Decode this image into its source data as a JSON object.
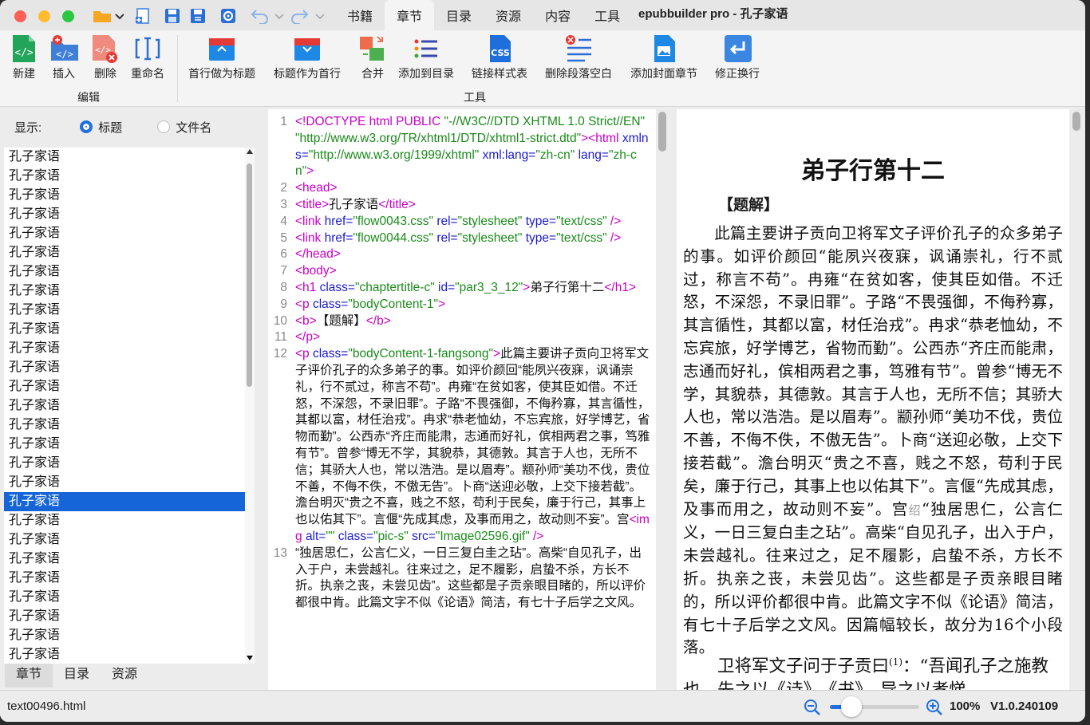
{
  "window": {
    "title": "epubbuilder pro - 孔子家语"
  },
  "menu": {
    "tabs": [
      "书籍",
      "章节",
      "目录",
      "资源",
      "内容",
      "工具"
    ],
    "active_tab": "章节"
  },
  "ribbon": {
    "edit_group": {
      "label": "编辑",
      "buttons": [
        "新建",
        "插入",
        "删除",
        "重命名"
      ]
    },
    "tools_group": {
      "label": "工具",
      "buttons": [
        "首行做为标题",
        "标题作为首行",
        "合并",
        "添加到目录",
        "链接样式表",
        "删除段落空白",
        "添加封面章节",
        "修正换行"
      ]
    }
  },
  "left_panel": {
    "display_label": "显示:",
    "option_title": "标题",
    "option_filename": "文件名",
    "selected_option": "标题",
    "items": [
      "孔子家语",
      "孔子家语",
      "孔子家语",
      "孔子家语",
      "孔子家语",
      "孔子家语",
      "孔子家语",
      "孔子家语",
      "孔子家语",
      "孔子家语",
      "孔子家语",
      "孔子家语",
      "孔子家语",
      "孔子家语",
      "孔子家语",
      "孔子家语",
      "孔子家语",
      "孔子家语",
      "孔子家语",
      "孔子家语",
      "孔子家语",
      "孔子家语",
      "孔子家语",
      "孔子家语",
      "孔子家语",
      "孔子家语",
      "孔子家语"
    ],
    "selected_index": 18,
    "bottom_tabs": [
      "章节",
      "目录",
      "资源"
    ],
    "active_bottom_tab": "章节"
  },
  "editor": {
    "lines": [
      {
        "n": "1",
        "parts": [
          [
            "t",
            "<!DOCTYPE html PUBLIC "
          ],
          [
            "s",
            "\"-//W3C//DTD XHTML 1.0 Strict//EN\" \"http://www.w3.org/TR/xhtml1/DTD/xhtml1-strict.dtd\""
          ],
          [
            "t",
            "><html "
          ],
          [
            "a",
            "xmlns="
          ],
          [
            "s",
            "\"http://www.w3.org/1999/xhtml\" "
          ],
          [
            "a",
            "xml:lang="
          ],
          [
            "s",
            "\"zh-cn\" "
          ],
          [
            "a",
            "lang="
          ],
          [
            "s",
            "\"zh-cn\""
          ],
          [
            "t",
            ">"
          ]
        ]
      },
      {
        "n": "2",
        "parts": [
          [
            "t",
            "<head>"
          ]
        ]
      },
      {
        "n": "3",
        "parts": [
          [
            "t",
            "<title>"
          ],
          [
            "x",
            "孔子家语"
          ],
          [
            "t",
            "</title>"
          ]
        ]
      },
      {
        "n": "4",
        "parts": [
          [
            "t",
            "<link "
          ],
          [
            "a",
            "href="
          ],
          [
            "s",
            "\"flow0043.css\" "
          ],
          [
            "a",
            "rel="
          ],
          [
            "s",
            "\"stylesheet\" "
          ],
          [
            "a",
            "type="
          ],
          [
            "s",
            "\"text/css\" "
          ],
          [
            "t",
            "/>"
          ]
        ]
      },
      {
        "n": "5",
        "parts": [
          [
            "t",
            "<link "
          ],
          [
            "a",
            "href="
          ],
          [
            "s",
            "\"flow0044.css\" "
          ],
          [
            "a",
            "rel="
          ],
          [
            "s",
            "\"stylesheet\" "
          ],
          [
            "a",
            "type="
          ],
          [
            "s",
            "\"text/css\" "
          ],
          [
            "t",
            "/>"
          ]
        ]
      },
      {
        "n": "6",
        "parts": [
          [
            "t",
            "</head>"
          ]
        ]
      },
      {
        "n": "7",
        "parts": [
          [
            "t",
            "<body>"
          ]
        ]
      },
      {
        "n": "8",
        "parts": [
          [
            "t",
            "<h1 "
          ],
          [
            "a",
            "class="
          ],
          [
            "s",
            "\"chaptertitle-c\" "
          ],
          [
            "a",
            "id="
          ],
          [
            "s",
            "\"par3_3_12\""
          ],
          [
            "t",
            ">"
          ],
          [
            "x",
            "弟子行第十二"
          ],
          [
            "t",
            "</h1>"
          ]
        ]
      },
      {
        "n": "9",
        "parts": [
          [
            "t",
            "<p "
          ],
          [
            "a",
            "class="
          ],
          [
            "s",
            "\"bodyContent-1\""
          ],
          [
            "t",
            ">"
          ]
        ]
      },
      {
        "n": "10",
        "parts": [
          [
            "t",
            "<b>"
          ],
          [
            "x",
            "【题解】"
          ],
          [
            "t",
            "</b>"
          ]
        ]
      },
      {
        "n": "11",
        "parts": [
          [
            "t",
            "</p>"
          ]
        ]
      },
      {
        "n": "12",
        "parts": [
          [
            "t",
            "<p "
          ],
          [
            "a",
            "class="
          ],
          [
            "s",
            "\"bodyContent-1-fangsong\""
          ],
          [
            "t",
            ">"
          ],
          [
            "x",
            "此篇主要讲子贡向卫将军文子评价孔子的众多弟子的事。如评价颜回“能夙兴夜寐，讽诵崇礼，行不贰过，称言不苟”。冉雍“在贫如客，使其臣如借。不迁怒，不深怨，不录旧罪”。子路“不畏强御，不侮矜寡，其言循性，其都以富，材任治戎”。冉求“恭老恤幼，不忘宾旅，好学博艺，省物而勤”。公西赤“齐庄而能肃，志通而好礼，傧相两君之事，笃雅有节”。曾参“博无不学，其貌恭，其德敦。其言于人也，无所不信；其骄大人也，常以浩浩。是以眉寿”。颛孙师“美功不伐，贵位不善，不侮不佚，不傲无告”。卜商“送迎必敬，上交下接若截”。澹台明灭“贵之不喜，贱之不怒，苟利于民矣，廉于行己，其事上也以佑其下”。言偃“先成其虑，及事而用之，故动则不妄”。宫"
          ],
          [
            "t",
            "<img "
          ],
          [
            "a",
            "alt="
          ],
          [
            "s",
            "\"\" "
          ],
          [
            "a",
            "class="
          ],
          [
            "s",
            "\"pic-s\" "
          ],
          [
            "a",
            "src="
          ],
          [
            "s",
            "\"Image02596.gif\" "
          ],
          [
            "t",
            "/>"
          ]
        ]
      },
      {
        "n": "13",
        "parts": [
          [
            "x",
            "“独居思仁，公言仁义，一日三复白圭之玷”。高柴“自见孔子，出入于户，未尝越礼。往来过之，足不履影，启蛰不杀，方长不折。执亲之丧，未尝见齿”。这些都是子贡亲眼目睹的，所以评价都很中肯。此篇文字不似《论语》简洁，有七十子后学之文风。"
          ]
        ]
      }
    ]
  },
  "preview": {
    "title": "弟子行第十二",
    "subtitle": "【题解】",
    "body": "此篇主要讲子贡向卫将军文子评价孔子的众多弟子的事。如评价颜回“能夙兴夜寐，讽诵崇礼，行不贰过，称言不苟”。冉雍“在贫如客，使其臣如借。不迁怒，不深怨，不录旧罪”。子路“不畏强御，不侮矜寡，其言循性，其都以富，材任治戎”。冉求“恭老恤幼，不忘宾旅，好学博艺，省物而勤”。公西赤“齐庄而能肃，志通而好礼，傧相两君之事，笃雅有节”。曾参“博无不学，其貌恭，其德敦。其言于人也，无所不信；其骄大人也，常以浩浩。是以眉寿”。颛孙师“美功不伐，贵位不善，不侮不佚，不傲无告”。卜商“送迎必敬，上交下接若截”。澹台明灭“贵之不喜，贱之不怒，苟利于民矣，廉于行己，其事上也以佑其下”。言偃“先成其虑，及事而用之，故动则不妄”。宫",
    "body_glyph": "绍",
    "body_rest": "“独居思仁，公言仁义，一日三复白圭之玷”。高柴“自见孔子，出入于户，未尝越礼。往来过之，足不履影，启蛰不杀，方长不折。执亲之丧，未尝见齿”。这些都是子贡亲眼目睹的，所以评价都很中肯。此篇文字不似《论语》简洁，有七十子后学之文风。因篇幅较长，故分为16个小段落。",
    "p2_start": "卫将军文子问于子贡曰",
    "p2_note": "(1)",
    "p2_rest": "：“吾闻孔子之施教也，先之以《诗》，《书》，导之以孝悌"
  },
  "status": {
    "file": "text00496.html",
    "zoom": "100%",
    "zoom_level": 0.25,
    "version": "V1.0.240109"
  },
  "colors": {
    "accent": "#1565d8",
    "tag": "#c800c8",
    "attr": "#1a1acf",
    "string": "#1a8a1a"
  }
}
